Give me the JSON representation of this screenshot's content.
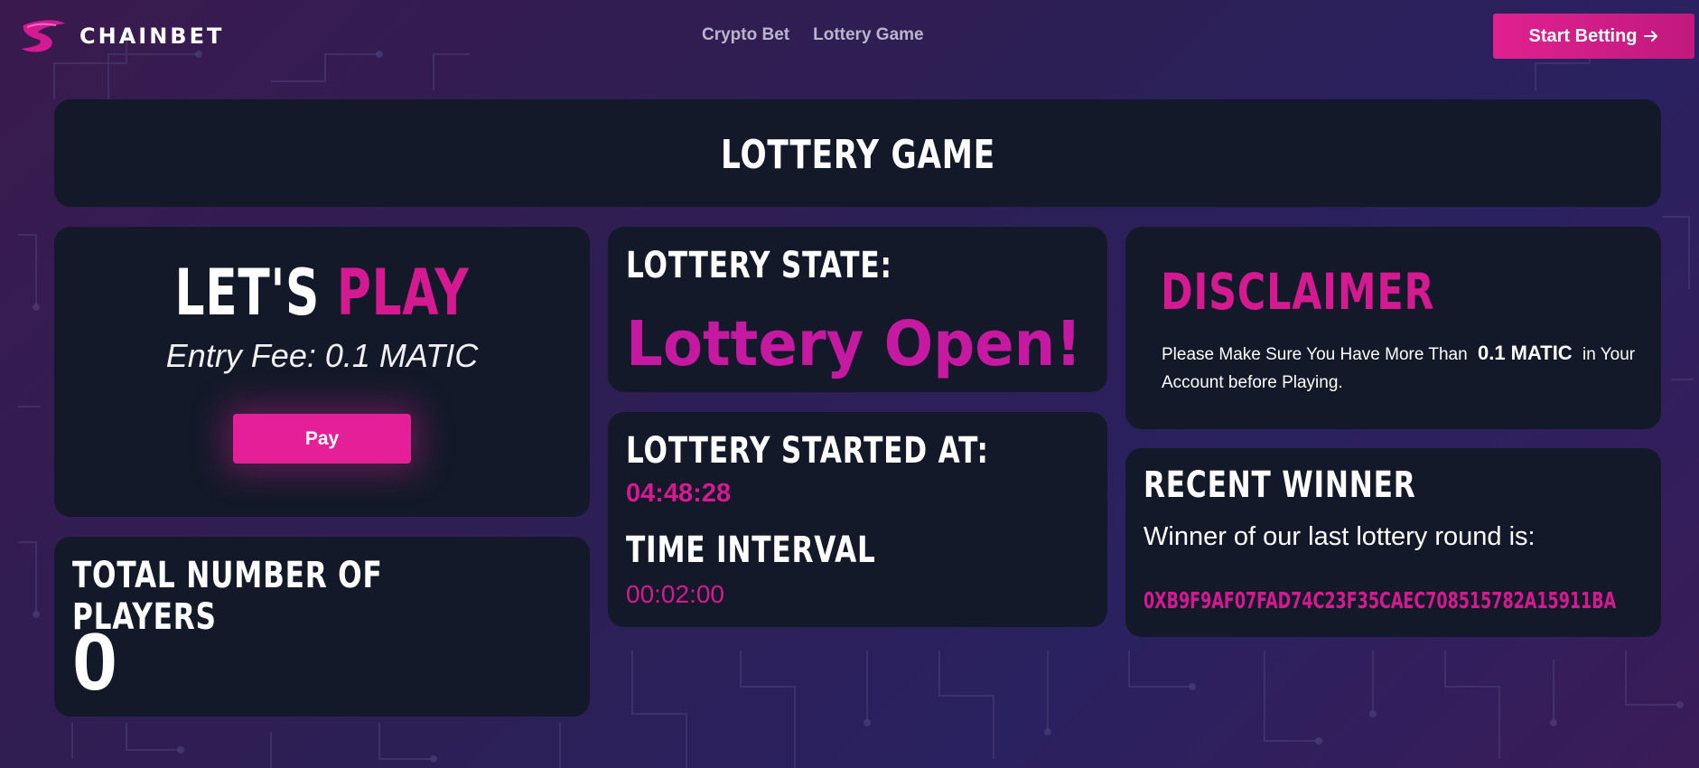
{
  "brand": {
    "name": "CHAINBET",
    "accent": "#d51a91",
    "background": "#2c1f55",
    "card": "#131929"
  },
  "nav": {
    "links": [
      {
        "label": "Crypto Bet"
      },
      {
        "label": "Lottery Game"
      }
    ],
    "cta_label": "Start Betting",
    "cta_icon": "arrow-right-icon"
  },
  "page": {
    "title": "LOTTERY GAME"
  },
  "play": {
    "heading_white": "LET'S",
    "heading_pink": "PLAY",
    "entry_fee": "Entry Fee: 0.1 MATIC",
    "pay_label": "Pay"
  },
  "players": {
    "label": "TOTAL NUMBER OF PLAYERS",
    "count": "0"
  },
  "state": {
    "label": "LOTTERY STATE:",
    "value": "Lottery Open!"
  },
  "timing": {
    "started_label": "LOTTERY STARTED AT:",
    "started_value": "04:48:28",
    "interval_label": "TIME INTERVAL",
    "interval_value": "00:02:00"
  },
  "disclaimer": {
    "title": "DISCLAIMER",
    "text_before": "Please Make Sure You Have More Than",
    "amount": "0.1 MATIC",
    "text_after": "in Your Account before Playing."
  },
  "winner": {
    "label": "RECENT WINNER",
    "text": "Winner of our last lottery round is:",
    "address": "0XB9F9AF07FAD74C23F35CAEC708515782A15911BA"
  }
}
